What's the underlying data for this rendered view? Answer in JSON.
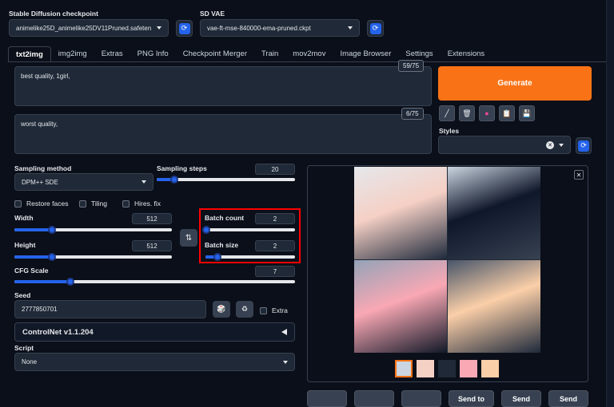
{
  "checkpoint": {
    "label": "Stable Diffusion checkpoint",
    "value": "animelike25D_animelike25DV11Pruned.safeten"
  },
  "vae": {
    "label": "SD VAE",
    "value": "vae-ft-mse-840000-ema-pruned.ckpt"
  },
  "tabs": [
    "txt2img",
    "img2img",
    "Extras",
    "PNG Info",
    "Checkpoint Merger",
    "Train",
    "mov2mov",
    "Image Browser",
    "Settings",
    "Extensions"
  ],
  "prompt": {
    "value": "best quality, 1girl,",
    "counter": "59/75"
  },
  "negative_prompt": {
    "value": "worst quality,",
    "counter": "6/75"
  },
  "generate_label": "Generate",
  "styles_label": "Styles",
  "sampling_method": {
    "label": "Sampling method",
    "value": "DPM++ SDE"
  },
  "sampling_steps": {
    "label": "Sampling steps",
    "value": "20",
    "fraction": 0.13
  },
  "checkboxes": {
    "restore_faces": "Restore faces",
    "tiling": "Tiling",
    "hires_fix": "Hires. fix"
  },
  "width": {
    "label": "Width",
    "value": "512",
    "fraction": 0.24
  },
  "height": {
    "label": "Height",
    "value": "512",
    "fraction": 0.24
  },
  "batch_count": {
    "label": "Batch count",
    "value": "2",
    "fraction": 0.01
  },
  "batch_size": {
    "label": "Batch size",
    "value": "2",
    "fraction": 0.13
  },
  "cfg_scale": {
    "label": "CFG Scale",
    "value": "7",
    "fraction": 0.2
  },
  "seed": {
    "label": "Seed",
    "value": "2777850701",
    "extra_label": "Extra"
  },
  "controlnet": {
    "label": "ControlNet v1.1.204"
  },
  "script": {
    "label": "Script",
    "value": "None"
  },
  "bottom_buttons": [
    "",
    "",
    "",
    "Send to",
    "Send",
    "Send"
  ],
  "colors": {
    "accent_orange": "#f97316",
    "accent_blue": "#2563eb",
    "highlight_red": "#ff0000"
  }
}
